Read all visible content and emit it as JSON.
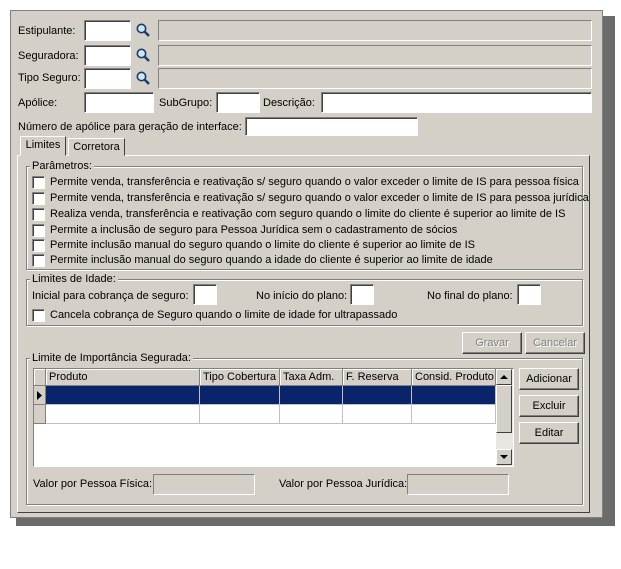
{
  "form": {
    "estipulante_label": "Estipulante:",
    "seguradora_label": "Seguradora:",
    "tipo_seguro_label": "Tipo Seguro:",
    "apolice_label": "Apólice:",
    "subgrupo_label": "SubGrupo:",
    "descricao_label": "Descrição:",
    "numero_apolice_label": "Número de apólice para geração de interface:"
  },
  "tabs": [
    {
      "label": "Limites",
      "active": true
    },
    {
      "label": "Corretora",
      "active": false
    }
  ],
  "parametros": {
    "legend": "Parâmetros:",
    "items": [
      "Permite venda, transferência e reativação s/ seguro quando o valor exceder o limite de IS para pessoa física",
      "Permite venda, transferência e reativação s/ seguro quando o valor exceder o limite de IS para pessoa jurídica",
      "Realiza venda, transferência e reativação com seguro quando o limite do cliente é superior ao limite de IS",
      "Permite a inclusão de seguro para Pessoa Jurídica sem o cadastramento de sócios",
      "Permite inclusão manual do seguro quando o limite do cliente é superior ao limite de IS",
      "Permite inclusão manual do seguro quando a idade do cliente é superior ao limite de idade"
    ]
  },
  "limites_idade": {
    "legend": "Limites de Idade:",
    "inicial_label": "Inicial para cobrança de seguro:",
    "inicio_plano_label": "No início do plano:",
    "final_plano_label": "No final do plano:",
    "cancela_label": "Cancela cobrança de Seguro quando o limite de idade for ultrapassado"
  },
  "buttons": {
    "gravar": "Gravar",
    "cancelar": "Cancelar",
    "adicionar": "Adicionar",
    "excluir": "Excluir",
    "editar": "Editar"
  },
  "importancia": {
    "legend": "Limite de Importância Segurada:",
    "columns": [
      "Produto",
      "Tipo Cobertura",
      "Taxa Adm.",
      "F. Reserva",
      "Consid. Produto"
    ],
    "valor_pf_label": "Valor por Pessoa Física:",
    "valor_pj_label": "Valor por Pessoa Jurídica:"
  },
  "colors": {
    "window_bg": "#d4d0c8",
    "selection": "#0a246a"
  }
}
